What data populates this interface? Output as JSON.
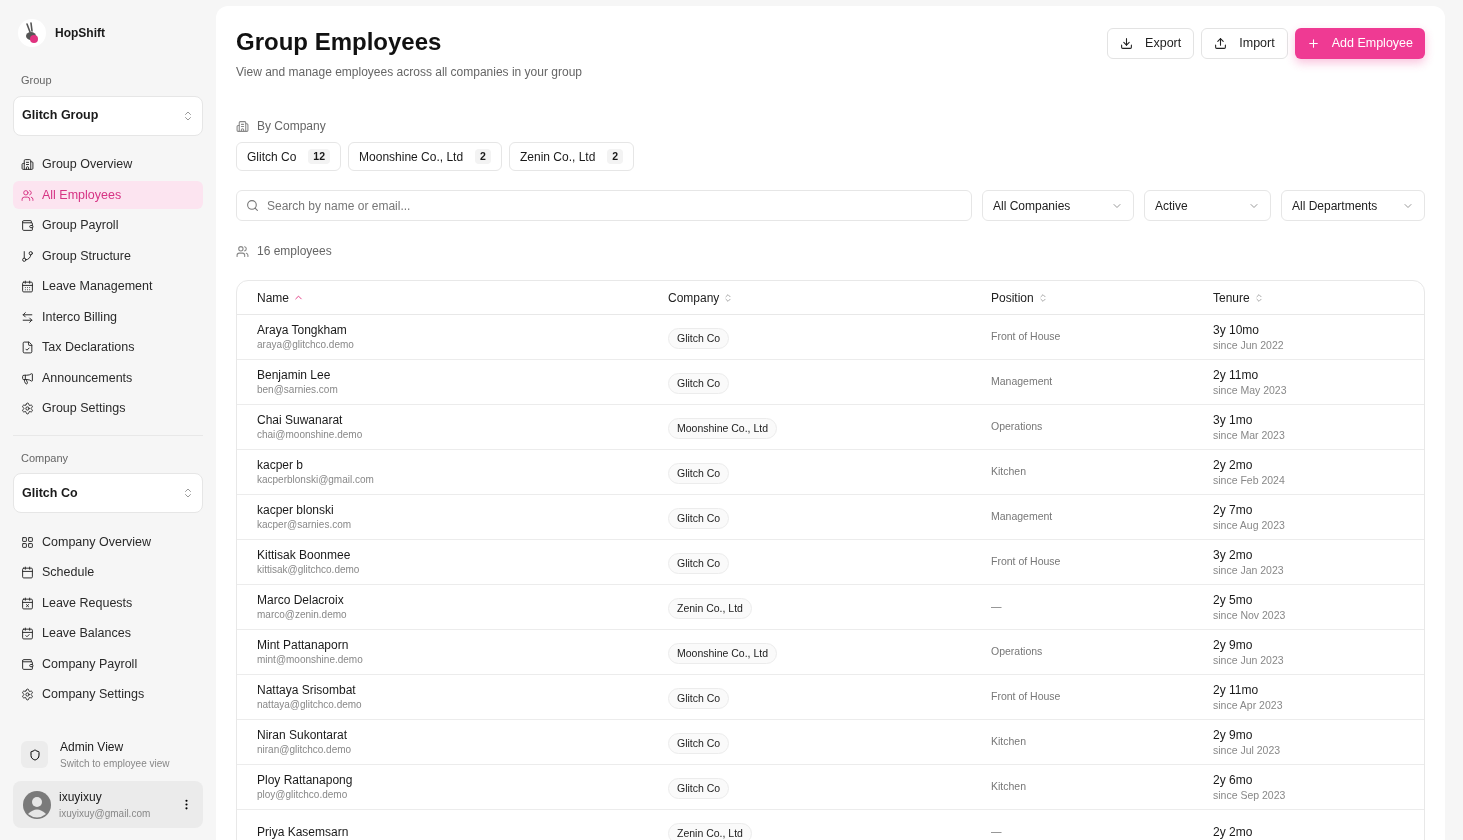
{
  "app": {
    "name": "HopShift"
  },
  "sidebar": {
    "group_label": "Group",
    "group_select": "Glitch Group",
    "group_items": [
      {
        "label": "Group Overview",
        "selected": false
      },
      {
        "label": "All Employees",
        "selected": true
      },
      {
        "label": "Group Payroll",
        "selected": false
      },
      {
        "label": "Group Structure",
        "selected": false
      },
      {
        "label": "Leave Management",
        "selected": false
      },
      {
        "label": "Interco Billing",
        "selected": false
      },
      {
        "label": "Tax Declarations",
        "selected": false
      },
      {
        "label": "Announcements",
        "selected": false
      },
      {
        "label": "Group Settings",
        "selected": false
      }
    ],
    "company_label": "Company",
    "company_select": "Glitch Co",
    "company_items": [
      {
        "label": "Company Overview",
        "selected": false
      },
      {
        "label": "Schedule",
        "selected": false
      },
      {
        "label": "Leave Requests",
        "selected": false
      },
      {
        "label": "Leave Balances",
        "selected": false
      },
      {
        "label": "Company Payroll",
        "selected": false
      },
      {
        "label": "Company Settings",
        "selected": false
      }
    ],
    "view_switch": {
      "title": "Admin View",
      "subtitle": "Switch to employee view"
    },
    "user": {
      "name": "ixuyixuy",
      "email": "ixuyixuy@gmail.com"
    }
  },
  "header": {
    "title": "Group Employees",
    "subtitle": "View and manage employees across all companies in your group",
    "buttons": [
      {
        "label": "Export",
        "kind": "export"
      },
      {
        "label": "Import",
        "kind": "import"
      },
      {
        "label": "Add Employee",
        "kind": "primary"
      }
    ]
  },
  "by_company": {
    "label": "By Company",
    "chips": [
      {
        "label": "Glitch Co",
        "count": "12"
      },
      {
        "label": "Moonshine Co., Ltd",
        "count": "2"
      },
      {
        "label": "Zenin Co., Ltd",
        "count": "2"
      }
    ]
  },
  "search": {
    "placeholder": "Search by name or email..."
  },
  "filters": [
    "All Companies",
    "Active",
    "All Departments"
  ],
  "count": "16 employees",
  "table": {
    "columns": [
      {
        "label": "Name",
        "sorted": true
      },
      {
        "label": "Company",
        "sorted": false
      },
      {
        "label": "Position",
        "sorted": false
      },
      {
        "label": "Tenure",
        "sorted": false
      }
    ],
    "rows": [
      {
        "name": "Araya Tongkham",
        "email": "araya@glitchco.demo",
        "company": "Glitch Co",
        "position": "Front of House",
        "tenure": "3y 10mo",
        "since": "since Jun 2022"
      },
      {
        "name": "Benjamin Lee",
        "email": "ben@sarnies.com",
        "company": "Glitch Co",
        "position": "Management",
        "tenure": "2y 11mo",
        "since": "since May 2023"
      },
      {
        "name": "Chai Suwanarat",
        "email": "chai@moonshine.demo",
        "company": "Moonshine Co., Ltd",
        "position": "Operations",
        "tenure": "3y 1mo",
        "since": "since Mar 2023"
      },
      {
        "name": "kacper b",
        "email": "kacperblonski@gmail.com",
        "company": "Glitch Co",
        "position": "Kitchen",
        "tenure": "2y 2mo",
        "since": "since Feb 2024"
      },
      {
        "name": "kacper blonski",
        "email": "kacper@sarnies.com",
        "company": "Glitch Co",
        "position": "Management",
        "tenure": "2y 7mo",
        "since": "since Aug 2023"
      },
      {
        "name": "Kittisak Boonmee",
        "email": "kittisak@glitchco.demo",
        "company": "Glitch Co",
        "position": "Front of House",
        "tenure": "3y 2mo",
        "since": "since Jan 2023"
      },
      {
        "name": "Marco Delacroix",
        "email": "marco@zenin.demo",
        "company": "Zenin Co., Ltd",
        "position": "—",
        "tenure": "2y 5mo",
        "since": "since Nov 2023"
      },
      {
        "name": "Mint Pattanaporn",
        "email": "mint@moonshine.demo",
        "company": "Moonshine Co., Ltd",
        "position": "Operations",
        "tenure": "2y 9mo",
        "since": "since Jun 2023"
      },
      {
        "name": "Nattaya Srisombat",
        "email": "nattaya@glitchco.demo",
        "company": "Glitch Co",
        "position": "Front of House",
        "tenure": "2y 11mo",
        "since": "since Apr 2023"
      },
      {
        "name": "Niran Sukontarat",
        "email": "niran@glitchco.demo",
        "company": "Glitch Co",
        "position": "Kitchen",
        "tenure": "2y 9mo",
        "since": "since Jul 2023"
      },
      {
        "name": "Ploy Rattanapong",
        "email": "ploy@glitchco.demo",
        "company": "Glitch Co",
        "position": "Kitchen",
        "tenure": "2y 6mo",
        "since": "since Sep 2023"
      },
      {
        "name": "Priya Kasemsarn",
        "company": "Zenin Co., Ltd",
        "position": "—",
        "tenure": "2y 2mo"
      }
    ]
  }
}
